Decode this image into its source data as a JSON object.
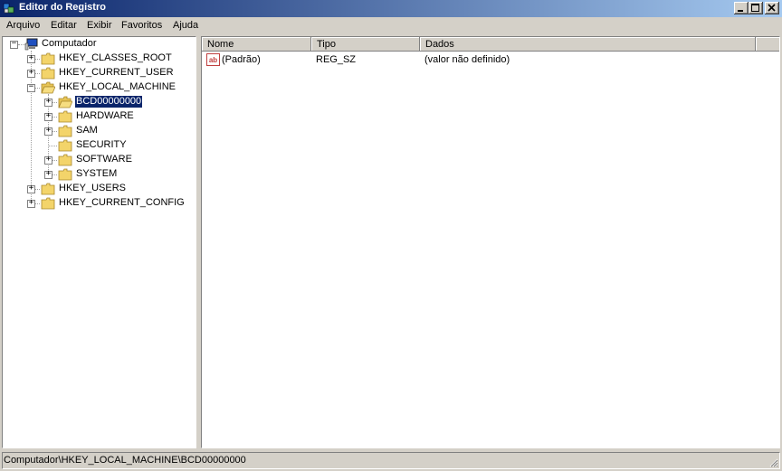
{
  "window": {
    "title": "Editor do Registro",
    "controls": {
      "minimize": "minimize-icon",
      "maximize": "maximize-icon",
      "close": "close-icon"
    }
  },
  "menu": [
    "Arquivo",
    "Editar",
    "Exibir",
    "Favoritos",
    "Ajuda"
  ],
  "tree": {
    "root": "Computador",
    "hives": [
      "HKEY_CLASSES_ROOT",
      "HKEY_CURRENT_USER",
      "HKEY_LOCAL_MACHINE",
      "HKEY_USERS",
      "HKEY_CURRENT_CONFIG"
    ],
    "hklm_children": [
      "BCD00000000",
      "HARDWARE",
      "SAM",
      "SECURITY",
      "SOFTWARE",
      "SYSTEM"
    ],
    "selected": "BCD00000000",
    "expander_collapsed": "+",
    "expander_expanded": "−"
  },
  "list": {
    "columns": [
      "Nome",
      "Tipo",
      "Dados"
    ],
    "rows": [
      {
        "name": "(Padrão)",
        "type": "REG_SZ",
        "data": "(valor não definido)",
        "icon": "string-value-icon",
        "icon_text": "ab"
      }
    ]
  },
  "status": "Computador\\HKEY_LOCAL_MACHINE\\BCD00000000",
  "colors": {
    "title_start": "#0a246a",
    "title_end": "#a6caf0",
    "selection": "#0a246a",
    "face": "#d4d0c8",
    "folder": "#f3d46a"
  }
}
